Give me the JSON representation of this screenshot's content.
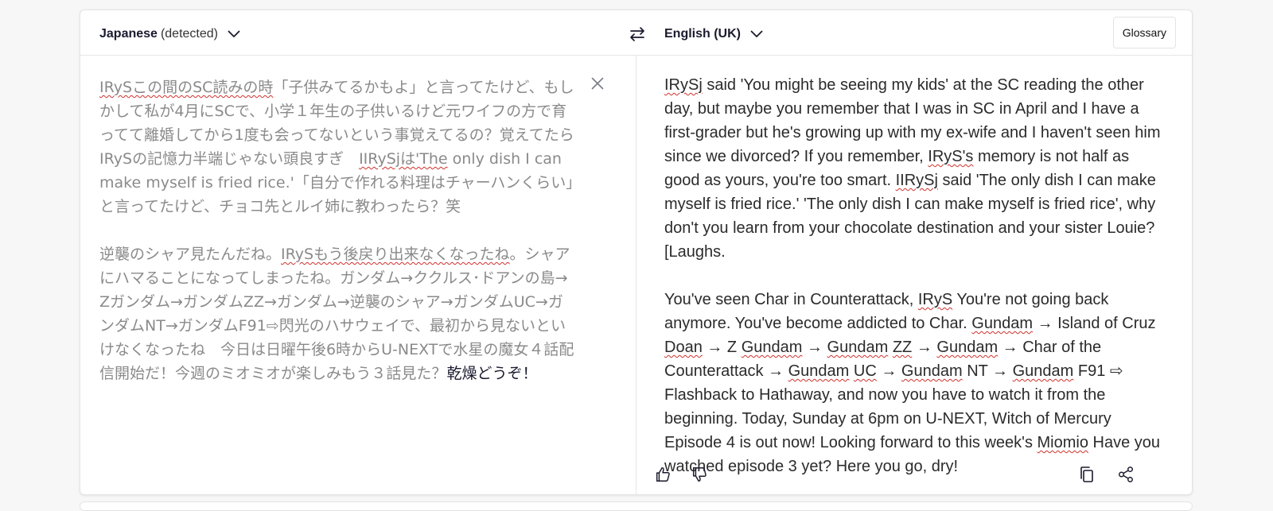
{
  "header": {
    "source_language": "Japanese",
    "source_detected_suffix": "(detected)",
    "target_language": "English (UK)",
    "glossary_label": "Glossary",
    "swap_icon": "swap-arrows-icon"
  },
  "source": {
    "para1": [
      {
        "t": "IRySこの間のSC読みの時",
        "s": true
      },
      {
        "t": "「子供みてるかもよ」と言ってたけど、もしかして私が4月にSCで、小学１年生の子供いるけど元ワイフの方で育ってて離婚してから1度も会ってないという事覚えてるの？覚えてたらIRySの記憶力半端じゃない頭良すぎ　",
        "s": false
      },
      {
        "t": "IIRySjは'The",
        "s": true
      },
      {
        "t": " only dish I can make myself is fried rice.'「自分で作れる料理はチャーハンくらい」と言ってたけど、チョコ先とルイ姉に教わったら？笑",
        "s": false
      }
    ],
    "para2": [
      {
        "t": "逆襲のシャア見たんだね。",
        "s": false
      },
      {
        "t": "IRySもう後戻り出来なくなったね",
        "s": true
      },
      {
        "t": "。シャアにハマることになってしまったね。ガンダム→ククルス･ドアンの島→Zガンダム→ガンダムZZ→ガンダム→逆襲のシャア→ガンダムUC→ガンダムNT→ガンダムF91⇨閃光のハサウェイで、最初から見ないといけなくなったね　今日は日曜午後6時からU-NEXTで水星の魔女４話配信開始だ！今週のミオミオが楽しみもう３話見た？",
        "s": false
      },
      {
        "t": "乾燥どうぞ！",
        "s": false,
        "dark": true
      }
    ]
  },
  "target": {
    "para1": [
      {
        "t": "IRySj",
        "s": true
      },
      {
        "t": " said 'You might be seeing my kids' at the SC reading the other day, but maybe you remember that I was in SC in April and I have a first-grader but he's growing up with my ex-wife and I haven't seen him since we divorced? If you remember, ",
        "s": false
      },
      {
        "t": "IRyS's",
        "s": true
      },
      {
        "t": " memory is not half as good as yours, you're too smart. ",
        "s": false
      },
      {
        "t": "IIRySj",
        "s": true
      },
      {
        "t": " said 'The only dish I can make myself is fried rice.' 'The only dish I can make myself is fried rice', why don't you learn from your chocolate destination and your sister Louie? [Laughs.",
        "s": false
      }
    ],
    "para2": [
      {
        "t": "You've seen Char in Counterattack, ",
        "s": false
      },
      {
        "t": "IRyS",
        "s": true
      },
      {
        "t": " You're not going back anymore. You've become addicted to Char. ",
        "s": false
      },
      {
        "t": "Gundam",
        "s": true
      },
      {
        "t": " → Island of Cruz ",
        "s": false
      },
      {
        "t": "Doan",
        "s": true
      },
      {
        "t": " → Z ",
        "s": false
      },
      {
        "t": "Gundam",
        "s": true
      },
      {
        "t": " → ",
        "s": false
      },
      {
        "t": "Gundam",
        "s": true
      },
      {
        "t": " ",
        "s": false
      },
      {
        "t": "ZZ",
        "s": true
      },
      {
        "t": " → ",
        "s": false
      },
      {
        "t": "Gundam",
        "s": true
      },
      {
        "t": " → Char of the Counterattack → ",
        "s": false
      },
      {
        "t": "Gundam",
        "s": true
      },
      {
        "t": " ",
        "s": false
      },
      {
        "t": "UC",
        "s": true
      },
      {
        "t": " → ",
        "s": false
      },
      {
        "t": "Gundam",
        "s": true
      },
      {
        "t": " NT → ",
        "s": false
      },
      {
        "t": "Gundam",
        "s": true
      },
      {
        "t": " F91 ⇨ Flashback to Hathaway, and now you have to watch it from the beginning. Today, Sunday at 6pm on U-NEXT, Witch of Mercury Episode 4 is out now! Looking forward to this week's ",
        "s": false
      },
      {
        "t": "Miomio",
        "s": true
      },
      {
        "t": " Have you watched episode 3 yet? Here you go, dry!",
        "s": false
      }
    ]
  },
  "actions": {
    "thumbs_up_icon": "thumbs-up-icon",
    "thumbs_down_icon": "thumbs-down-icon",
    "copy_icon": "copy-icon",
    "share_icon": "share-icon"
  }
}
